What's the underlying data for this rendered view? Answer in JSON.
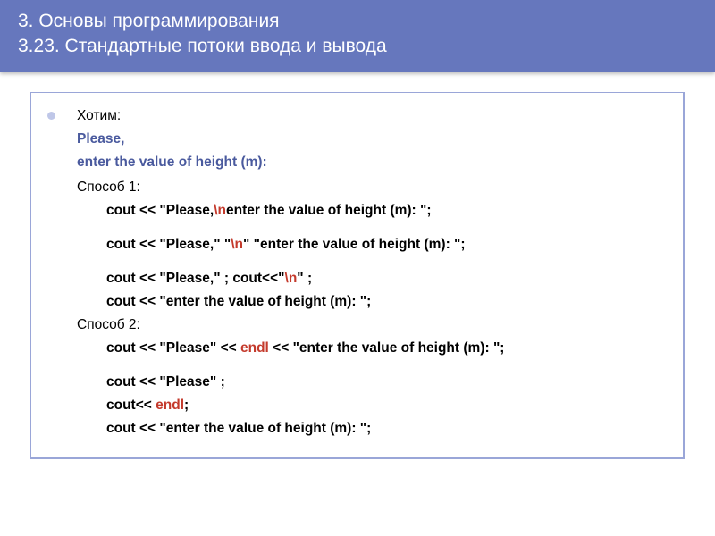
{
  "title": {
    "line1": "3. Основы программирования",
    "line2": "3.23. Стандартные потоки ввода и вывода"
  },
  "content": {
    "want_label": "Хотим:",
    "want_line1": "Please,",
    "want_line2": "enter the value of height (m):",
    "method1_label": "Способ 1:",
    "m1_l1_a": "cout << \"Please,",
    "m1_l1_b": "\\n",
    "m1_l1_c": "enter the value of height (m): \";",
    "m1_l2_a": "cout << \"Please,\"  \"",
    "m1_l2_b": "\\n",
    "m1_l2_c": "\"  \"enter the value of height (m): \";",
    "m1_l3_a": "cout << \"Please,\" ;  cout<<\"",
    "m1_l3_b": "\\n",
    "m1_l3_c": "\" ;",
    "m1_l4": "cout << \"enter the value of height (m): \";",
    "method2_label": "Способ 2:",
    "m2_l1_a": "cout << \"Please\" << ",
    "m2_l1_b": "endl",
    "m2_l1_c": " << \"enter the value of height (m): \";",
    "m2_l2": "cout << \"Please\" ;",
    "m2_l3_a": "cout<< ",
    "m2_l3_b": "endl",
    "m2_l3_c": ";",
    "m2_l4": "cout << \"enter the value of height (m): \";"
  }
}
